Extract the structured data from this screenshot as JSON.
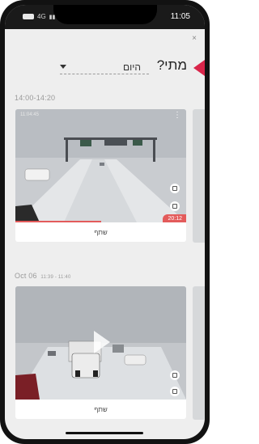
{
  "statusbar": {
    "network": "4G",
    "time": "11:05"
  },
  "header": {
    "when_label": "מתי?",
    "date_value": "היום"
  },
  "colors": {
    "accent": "#d9254a",
    "progress": "#e35b5b"
  },
  "sections": [
    {
      "label": "14:00-14:20",
      "label_small": "",
      "stamp": "11:04:45",
      "duration": "20:12",
      "share": "שתף",
      "progress_fraction": 0.5
    },
    {
      "label": "Oct 06",
      "label_small": "11:39 - 11:40",
      "stamp": "",
      "duration": "",
      "share": "שתף"
    }
  ],
  "close_symbol": "×",
  "icons": [
    "close-icon",
    "chevron-down-icon",
    "more-vert-icon",
    "grid-icon",
    "clip-icon",
    "play-icon"
  ]
}
